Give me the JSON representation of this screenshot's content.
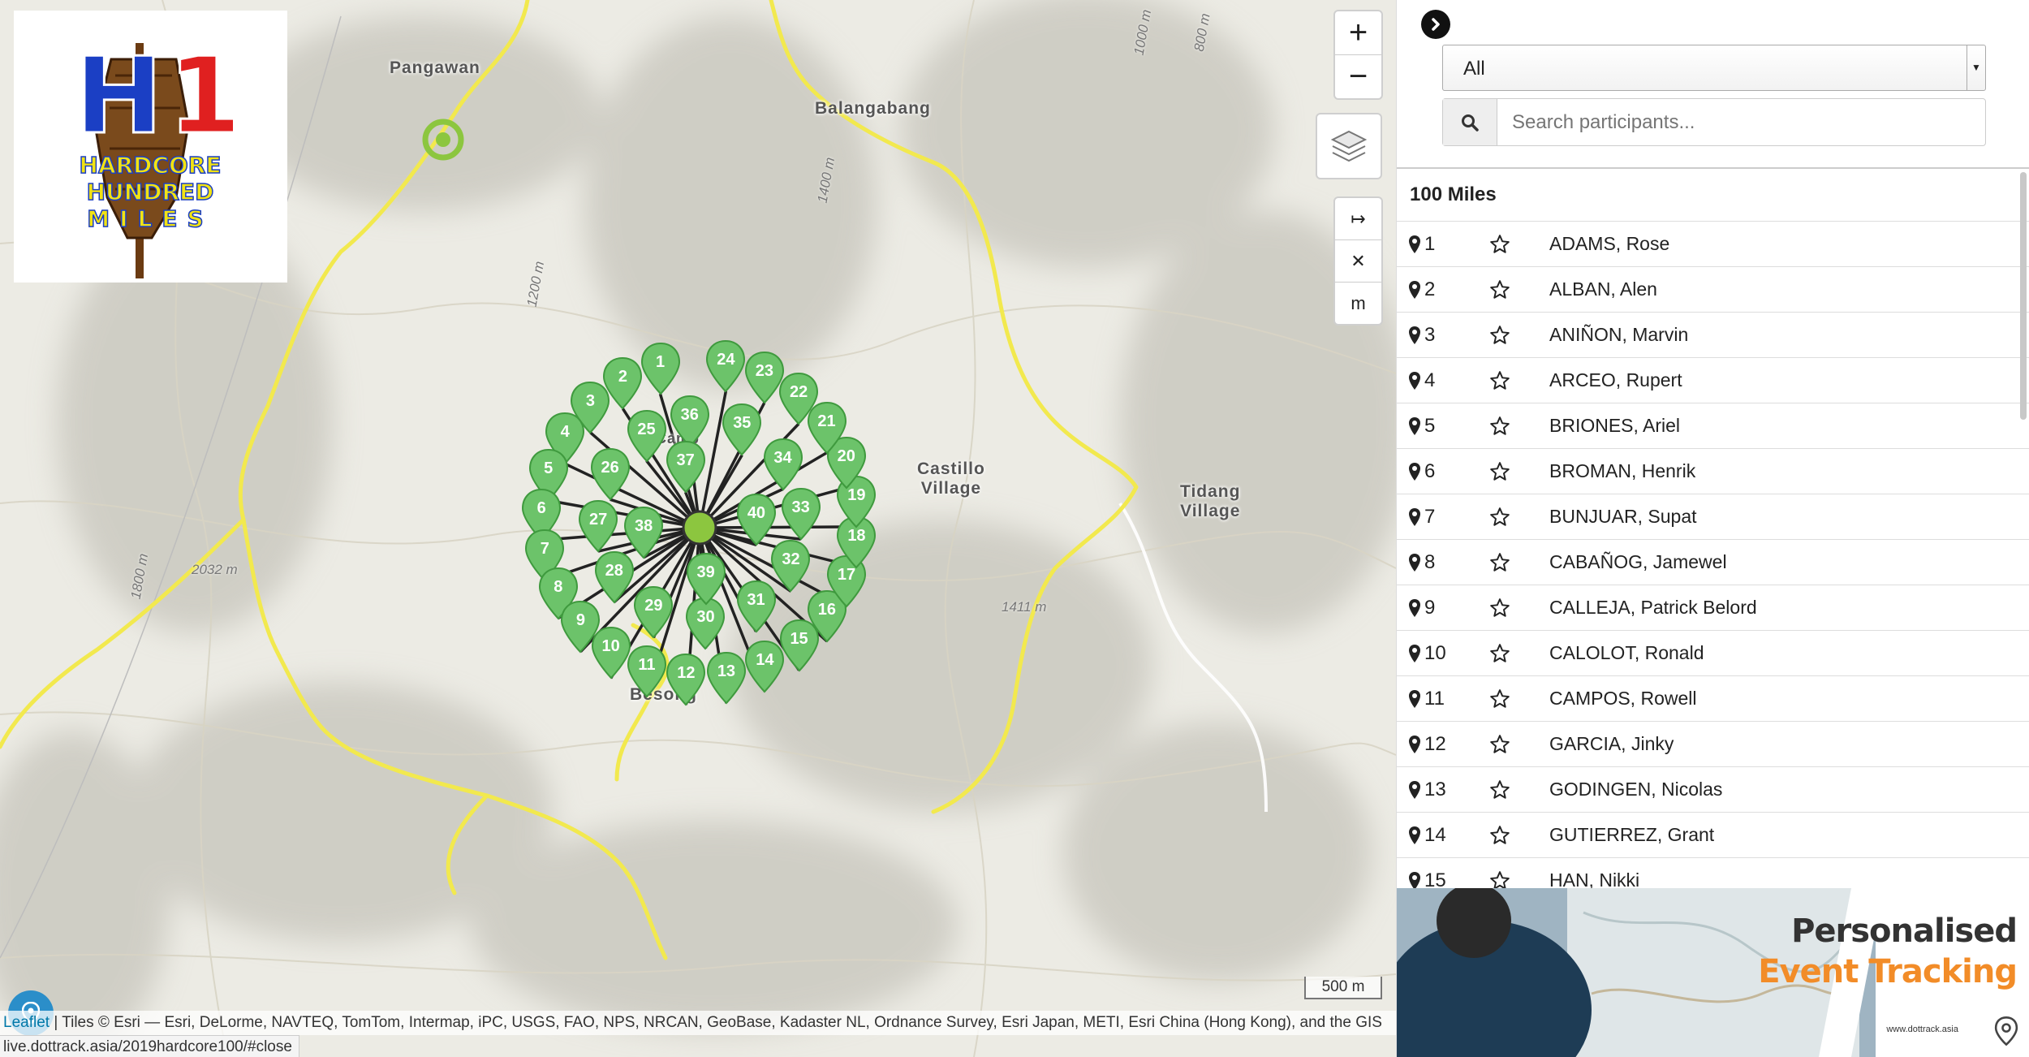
{
  "map": {
    "place_labels": [
      "Pangawan",
      "Balangabang",
      "Castillo\nVillage",
      "Tidang\nVillage",
      "Besong",
      "Camp"
    ],
    "elevation_labels": [
      "2032 m",
      "1411 m",
      "1200 m",
      "1400 m",
      "1800 m",
      "1000 m",
      "800 m"
    ],
    "cluster_markers": [
      "1",
      "2",
      "3",
      "4",
      "5",
      "6",
      "7",
      "8",
      "9",
      "10",
      "11",
      "12",
      "13",
      "14",
      "15",
      "16",
      "17",
      "18",
      "19",
      "20",
      "21",
      "22",
      "23",
      "24",
      "25",
      "26",
      "27",
      "28",
      "29",
      "30",
      "31",
      "32",
      "33",
      "34",
      "35",
      "36",
      "37",
      "38",
      "39",
      "40"
    ],
    "zoom_in": "+",
    "zoom_out": "−",
    "tool_buttons": [
      "↦",
      "✕",
      "m"
    ],
    "scale": "500 m",
    "attribution_leaflet": "Leaflet",
    "attribution_text": " | Tiles © Esri — Esri, DeLorme, NAVTEQ, TomTom, Intermap, iPC, USGS, FAO, NPS, NRCAN, GeoBase, Kadaster NL, Ordnance Survey, Esri Japan, METI, Esri China (Hong Kong), and the GIS",
    "status_url": "live.dottrack.asia/2019hardcore100/#close",
    "logo_text": {
      "h": "H",
      "one": "1",
      "line1": "HARDCORE",
      "line2": "HUNDRED",
      "line3": "MILES"
    },
    "colors": {
      "road": "#f2e94e",
      "marker": "#6cc36a",
      "marker_border": "#3f9a3e",
      "logo_blue": "#1b3fc4",
      "logo_red": "#e02020",
      "logo_yellow": "#f2e313"
    }
  },
  "panel": {
    "filter_value": "All",
    "search_placeholder": "Search participants...",
    "group_title": "100 Miles",
    "participants": [
      {
        "num": "1",
        "name": "ADAMS, Rose"
      },
      {
        "num": "2",
        "name": "ALBAN, Alen"
      },
      {
        "num": "3",
        "name": "ANIÑON, Marvin"
      },
      {
        "num": "4",
        "name": "ARCEO, Rupert"
      },
      {
        "num": "5",
        "name": "BRIONES, Ariel"
      },
      {
        "num": "6",
        "name": "BROMAN, Henrik"
      },
      {
        "num": "7",
        "name": "BUNJUAR, Supat"
      },
      {
        "num": "8",
        "name": "CABAÑOG, Jamewel"
      },
      {
        "num": "9",
        "name": "CALLEJA, Patrick Belord"
      },
      {
        "num": "10",
        "name": "CALOLOT, Ronald"
      },
      {
        "num": "11",
        "name": "CAMPOS, Rowell"
      },
      {
        "num": "12",
        "name": "GARCIA, Jinky"
      },
      {
        "num": "13",
        "name": "GODINGEN, Nicolas"
      },
      {
        "num": "14",
        "name": "GUTIERREZ, Grant"
      },
      {
        "num": "15",
        "name": "HAN, Nikki"
      }
    ],
    "banner": {
      "line1": "Personalised",
      "line2": "Event Tracking",
      "url": "www.dottrack.asia"
    }
  }
}
